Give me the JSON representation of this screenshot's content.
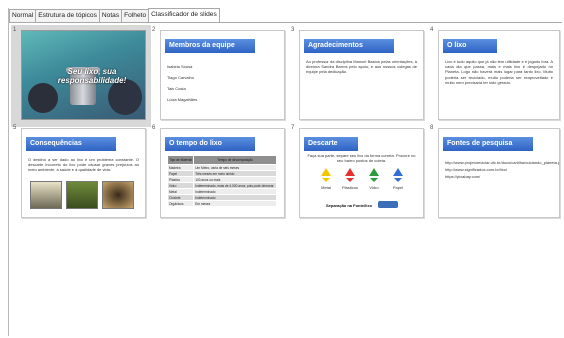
{
  "tabs": [
    "Normal",
    "Estrutura de tópicos",
    "Notas",
    "Folheto",
    "Classificador de slides"
  ],
  "active_tab": "Classificador de slides",
  "slides": [
    {
      "number": "1",
      "title": "",
      "cover_title": "Seu lixo, sua\nresponsabilidade!"
    },
    {
      "number": "2",
      "title": "Membros da equipe",
      "bullets": [
        "Isabela Sousa",
        "Tiago Carvalho",
        "Tais Costa",
        "Lúcia Magalhães"
      ]
    },
    {
      "number": "3",
      "title": "Agradecimentos",
      "text": "Ao professor da disciplina Manoel Bastos pelas orientações, à diretora Sandra Barros pelo apoio, e aos nossos colegas de equipe pela dedicação."
    },
    {
      "number": "4",
      "title": "O lixo",
      "text": "Lixo é tudo aquilo que já não tem utilidade e é jogado fora. A cada dia que passa, mais e mais lixo é despejado no Planeta. Logo não haverá mais lugar para tanto lixo. Muito poderia ser reciclado, muito poderia ser reaproveitado e muito nem precisaria ter sido gerado."
    },
    {
      "number": "5",
      "title": "Consequências",
      "text": "O destino a ser dado ao lixo é um problema constante. O descarte incorreto do lixo pode causar graves prejuízos ao meio ambiente, à saúde e à qualidade de vida."
    },
    {
      "number": "6",
      "title": "O tempo do lixo",
      "table_headers": [
        "Tipo de Material",
        "Tempo de decomposição"
      ],
      "table_rows": [
        [
          "Madeira",
          "Um Metro, varia de seis meses"
        ],
        [
          "Papel",
          "Três meses em meio úmido"
        ],
        [
          "Plástico",
          "100 anos ou mais"
        ],
        [
          "Vidro",
          "Indeterminado, mais de 4.000 anos, pois pode demorar"
        ],
        [
          "Metal",
          "Indeterminado"
        ],
        [
          "Chiclete",
          "Indeterminado"
        ],
        [
          "Orgânicos",
          "Em meses"
        ]
      ]
    },
    {
      "number": "7",
      "title": "Descarte",
      "text": "Faça sua parte, separe seu lixo da forma correta. Procure no seu bairro postos de coleta.",
      "bins": [
        "Metal",
        "Plásticos",
        "Vidro",
        "Papel"
      ],
      "footer": "Separação na Fonte/lixo"
    },
    {
      "number": "8",
      "title": "Fontes de pesquisa",
      "links": [
        "http://www.projetoreciclar.ufc.br/docs/cartilha/cuidando_planeta.pdf",
        "http://www.significados.com.br/lixo/",
        "https://pixabay.com/"
      ]
    }
  ],
  "colors": {
    "title_bar": "#3a6fd0",
    "selected": "#d8d8d8",
    "bin_colors": [
      "#f2c500",
      "#e53030",
      "#2e9b3a",
      "#2f6fd6"
    ]
  }
}
